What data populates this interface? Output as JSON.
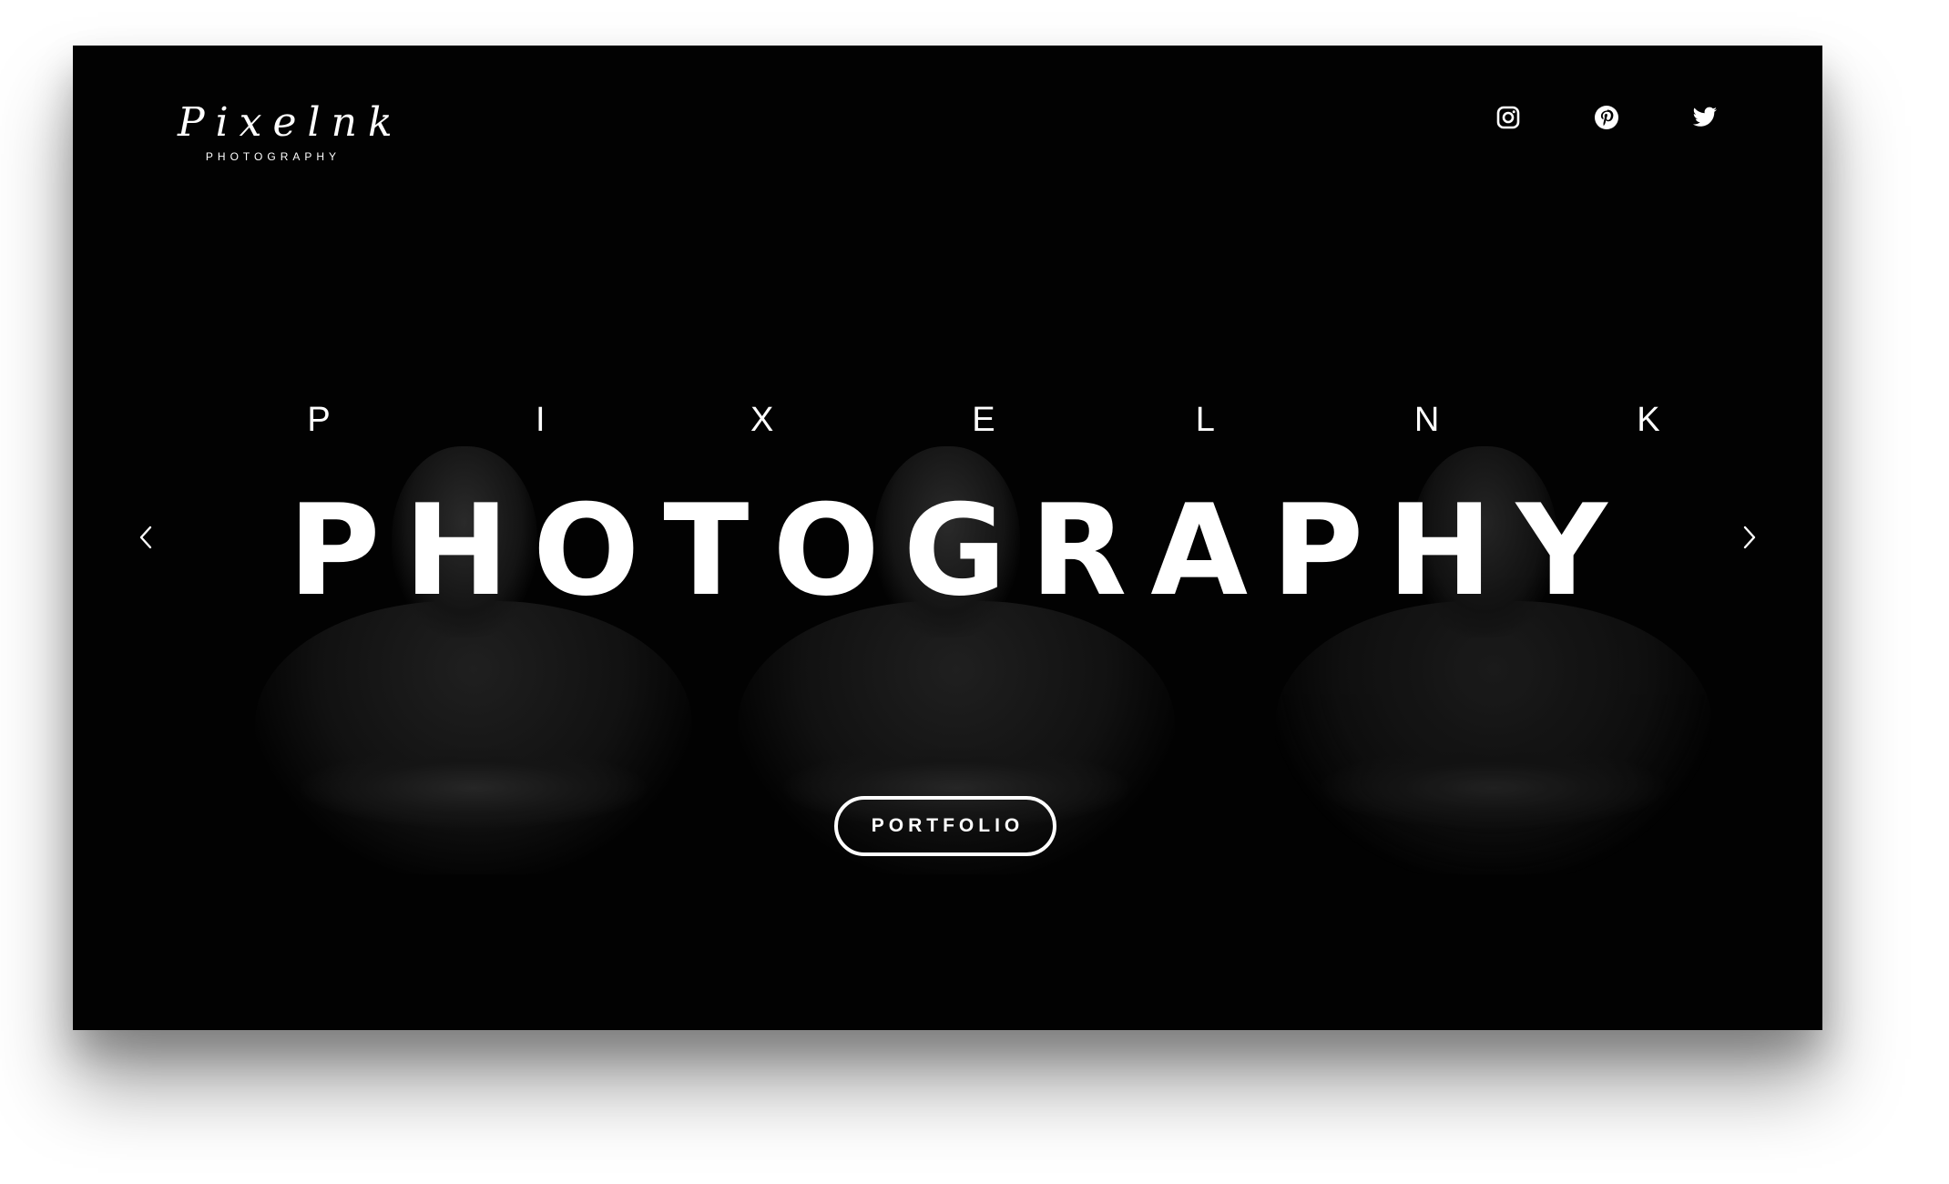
{
  "brand": {
    "logo_script": "Pixelnk",
    "logo_subtitle": "PHOTOGRAPHY"
  },
  "social": [
    {
      "name": "instagram",
      "icon": "instagram-icon"
    },
    {
      "name": "pinterest",
      "icon": "pinterest-icon"
    },
    {
      "name": "twitter",
      "icon": "twitter-icon"
    }
  ],
  "hero": {
    "kicker_letters": [
      "P",
      "I",
      "X",
      "E",
      "L",
      "N",
      "K"
    ],
    "headline": "PHOTOGRAPHY",
    "cta_label": "PORTFOLIO"
  },
  "carousel": {
    "prev_icon": "chevron-left-icon",
    "next_icon": "chevron-right-icon"
  },
  "colors": {
    "background": "#020202",
    "text": "#ffffff",
    "page": "#ffffff"
  }
}
